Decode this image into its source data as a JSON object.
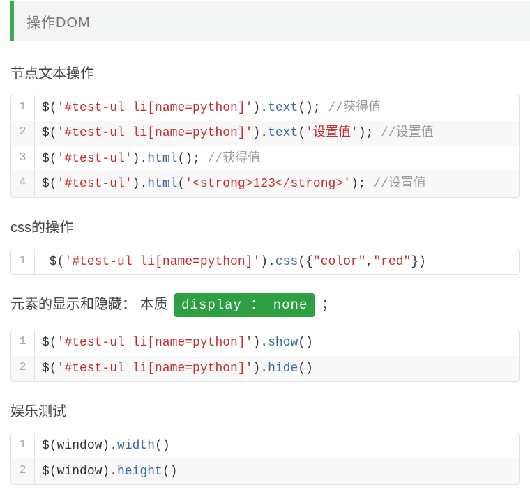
{
  "callout": {
    "title": "操作DOM"
  },
  "sections": {
    "s1": {
      "heading": "节点文本操作",
      "code": [
        [
          {
            "t": "$("
          },
          {
            "t": "'#test-ul li[name=python]'",
            "cls": "tok-str"
          },
          {
            "t": ")."
          },
          {
            "t": "text",
            "cls": "tok-fn"
          },
          {
            "t": "(); "
          },
          {
            "t": "//获得值",
            "cls": "tok-comm"
          }
        ],
        [
          {
            "t": "$("
          },
          {
            "t": "'#test-ul li[name=python]'",
            "cls": "tok-str"
          },
          {
            "t": ")."
          },
          {
            "t": "text",
            "cls": "tok-fn"
          },
          {
            "t": "("
          },
          {
            "t": "'设置值'",
            "cls": "tok-str"
          },
          {
            "t": "); "
          },
          {
            "t": "//设置值",
            "cls": "tok-comm"
          }
        ],
        [
          {
            "t": "$("
          },
          {
            "t": "'#test-ul'",
            "cls": "tok-str"
          },
          {
            "t": ")."
          },
          {
            "t": "html",
            "cls": "tok-fn"
          },
          {
            "t": "(); "
          },
          {
            "t": "//获得值",
            "cls": "tok-comm"
          }
        ],
        [
          {
            "t": "$("
          },
          {
            "t": "'#test-ul'",
            "cls": "tok-str"
          },
          {
            "t": ")."
          },
          {
            "t": "html",
            "cls": "tok-fn"
          },
          {
            "t": "("
          },
          {
            "t": "'<strong>123</strong>'",
            "cls": "tok-str"
          },
          {
            "t": "); "
          },
          {
            "t": "//设置值",
            "cls": "tok-comm"
          }
        ]
      ]
    },
    "s2": {
      "heading": "css的操作",
      "code": [
        [
          {
            "t": " $("
          },
          {
            "t": "'#test-ul li[name=python]'",
            "cls": "tok-str"
          },
          {
            "t": ")."
          },
          {
            "t": "css",
            "cls": "tok-fn"
          },
          {
            "t": "({"
          },
          {
            "t": "\"color\"",
            "cls": "tok-key"
          },
          {
            "t": ","
          },
          {
            "t": "\"red\"",
            "cls": "tok-key"
          },
          {
            "t": "})"
          }
        ]
      ]
    },
    "s3": {
      "prefix": "元素的显示和隐藏：  本质",
      "badge": "display ：  none",
      "suffix": "；",
      "code": [
        [
          {
            "t": "$("
          },
          {
            "t": "'#test-ul li[name=python]'",
            "cls": "tok-str"
          },
          {
            "t": ")."
          },
          {
            "t": "show",
            "cls": "tok-fn"
          },
          {
            "t": "()"
          }
        ],
        [
          {
            "t": "$("
          },
          {
            "t": "'#test-ul li[name=python]'",
            "cls": "tok-str"
          },
          {
            "t": ")."
          },
          {
            "t": "hide",
            "cls": "tok-fn"
          },
          {
            "t": "()"
          }
        ]
      ]
    },
    "s4": {
      "heading": "娱乐测试",
      "code": [
        [
          {
            "t": "$("
          },
          {
            "t": "window",
            "cls": "tok-plain"
          },
          {
            "t": ")."
          },
          {
            "t": "width",
            "cls": "tok-fn"
          },
          {
            "t": "()"
          }
        ],
        [
          {
            "t": "$("
          },
          {
            "t": "window",
            "cls": "tok-plain"
          },
          {
            "t": ")."
          },
          {
            "t": "height",
            "cls": "tok-fn"
          },
          {
            "t": "()"
          }
        ]
      ]
    }
  }
}
